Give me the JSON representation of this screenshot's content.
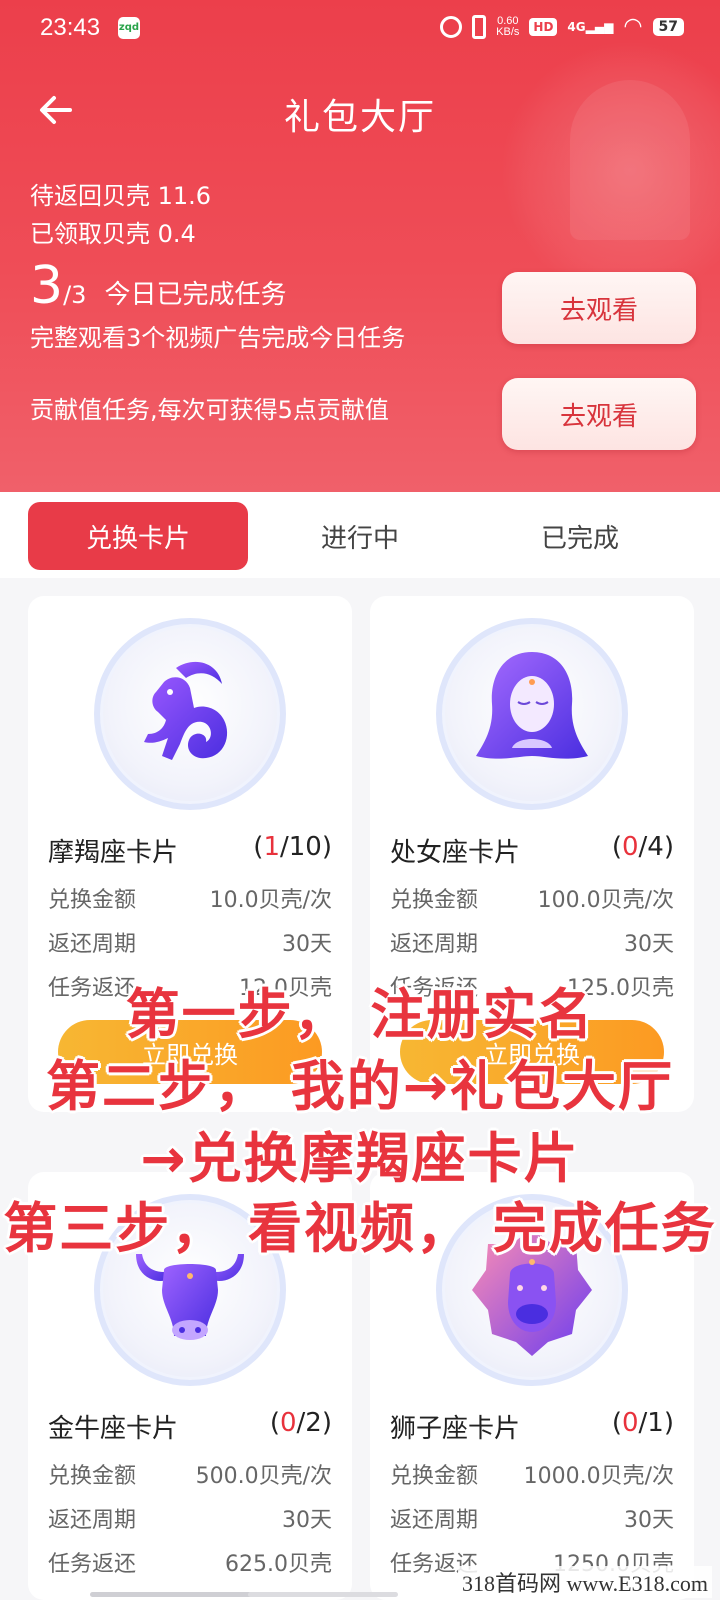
{
  "status_bar": {
    "time": "23:43",
    "app_badge": "zqd",
    "net_speed_value": "0.60",
    "net_speed_unit": "KB/s",
    "hd": "HD",
    "signal": "4G",
    "battery": "57"
  },
  "header": {
    "title": "礼包大厅",
    "pending_return": "待返回贝壳 11.6",
    "received": "已领取贝壳 0.4"
  },
  "tasks": {
    "done": "3",
    "total": "/3",
    "status": "今日已完成任务",
    "desc": "完整观看3个视频广告完成今日任务",
    "watch_label": "去观看",
    "contribution_desc": "贡献值任务,每次可获得5点贡献值",
    "watch2_label": "去观看"
  },
  "tabs": [
    {
      "label": "兑换卡片",
      "active": true
    },
    {
      "label": "进行中",
      "active": false
    },
    {
      "label": "已完成",
      "active": false
    }
  ],
  "labels": {
    "amount": "兑换金额",
    "period": "返还周期",
    "reward": "任务返还",
    "redeem": "立即兑换"
  },
  "cards": [
    {
      "name": "摩羯座卡片",
      "open": "(",
      "cur": "1",
      "rest": "/10)",
      "amount": "10.0贝壳/次",
      "period": "30天",
      "reward": "12.0贝壳",
      "icon": "capricorn-icon"
    },
    {
      "name": "处女座卡片",
      "open": "(",
      "cur": "0",
      "rest": "/4)",
      "amount": "100.0贝壳/次",
      "period": "30天",
      "reward": "125.0贝壳",
      "icon": "virgo-icon"
    },
    {
      "name": "金牛座卡片",
      "open": "(",
      "cur": "0",
      "rest": "/2)",
      "amount": "500.0贝壳/次",
      "period": "30天",
      "reward": "625.0贝壳",
      "icon": "taurus-icon"
    },
    {
      "name": "狮子座卡片",
      "open": "(",
      "cur": "0",
      "rest": "/1)",
      "amount": "1000.0贝壳/次",
      "period": "30天",
      "reward": "1250.0贝壳",
      "icon": "leo-icon"
    }
  ],
  "overlay": {
    "line1": "第一步， 注册实名",
    "line2": "第二步， 我的→礼包大厅",
    "line3": "→兑换摩羯座卡片",
    "line4": "第三步， 看视频， 完成任务"
  },
  "watermark": "318首码网 www.E318.com",
  "colors": {
    "primary": "#e83b48",
    "button_orange": "#fc9a22",
    "count_red": "#e8323c",
    "zodiac_purple": "#6a3cf0"
  }
}
